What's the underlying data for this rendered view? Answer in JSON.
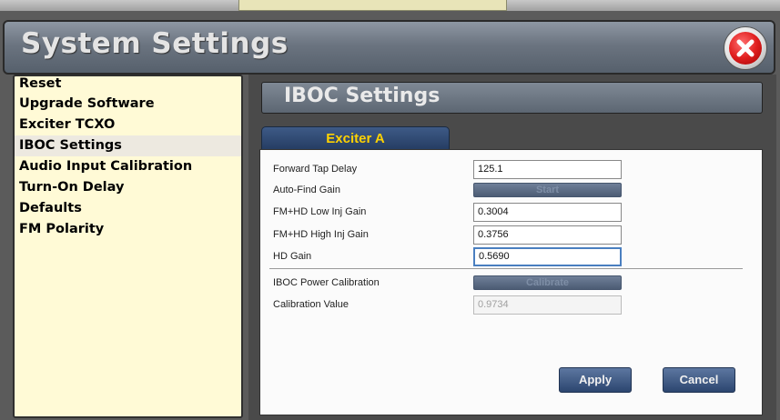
{
  "window": {
    "title": "System Settings",
    "close_icon": "close-icon"
  },
  "sidebar": {
    "items": [
      {
        "label": "Reset",
        "selected": false
      },
      {
        "label": "Upgrade Software",
        "selected": false
      },
      {
        "label": "Exciter TCXO",
        "selected": false
      },
      {
        "label": "IBOC Settings",
        "selected": true
      },
      {
        "label": "Audio Input Calibration",
        "selected": false
      },
      {
        "label": "Turn-On Delay",
        "selected": false
      },
      {
        "label": "Defaults",
        "selected": false
      },
      {
        "label": "FM Polarity",
        "selected": false
      }
    ]
  },
  "main": {
    "title": "IBOC Settings",
    "tab_label": "Exciter A",
    "fields": {
      "forward_tap_delay": {
        "label": "Forward Tap Delay",
        "value": "125.1"
      },
      "auto_find_gain": {
        "label": "Auto-Find Gain",
        "button_label": "Start"
      },
      "fm_hd_low_inj_gain": {
        "label": "FM+HD Low Inj Gain",
        "value": "0.3004"
      },
      "fm_hd_high_inj_gain": {
        "label": "FM+HD High Inj Gain",
        "value": "0.3756"
      },
      "hd_gain": {
        "label": "HD Gain",
        "value": "0.5690"
      },
      "iboc_power_calibration": {
        "label": "IBOC Power Calibration",
        "button_label": "Calibrate"
      },
      "calibration_value": {
        "label": "Calibration Value",
        "value": "0.9734"
      }
    },
    "apply_label": "Apply",
    "cancel_label": "Cancel"
  },
  "colors": {
    "sidebar_bg": "#fffad6",
    "tab_text": "#ffd200",
    "header_bg": "#6b7480",
    "close_red": "#e12020"
  }
}
